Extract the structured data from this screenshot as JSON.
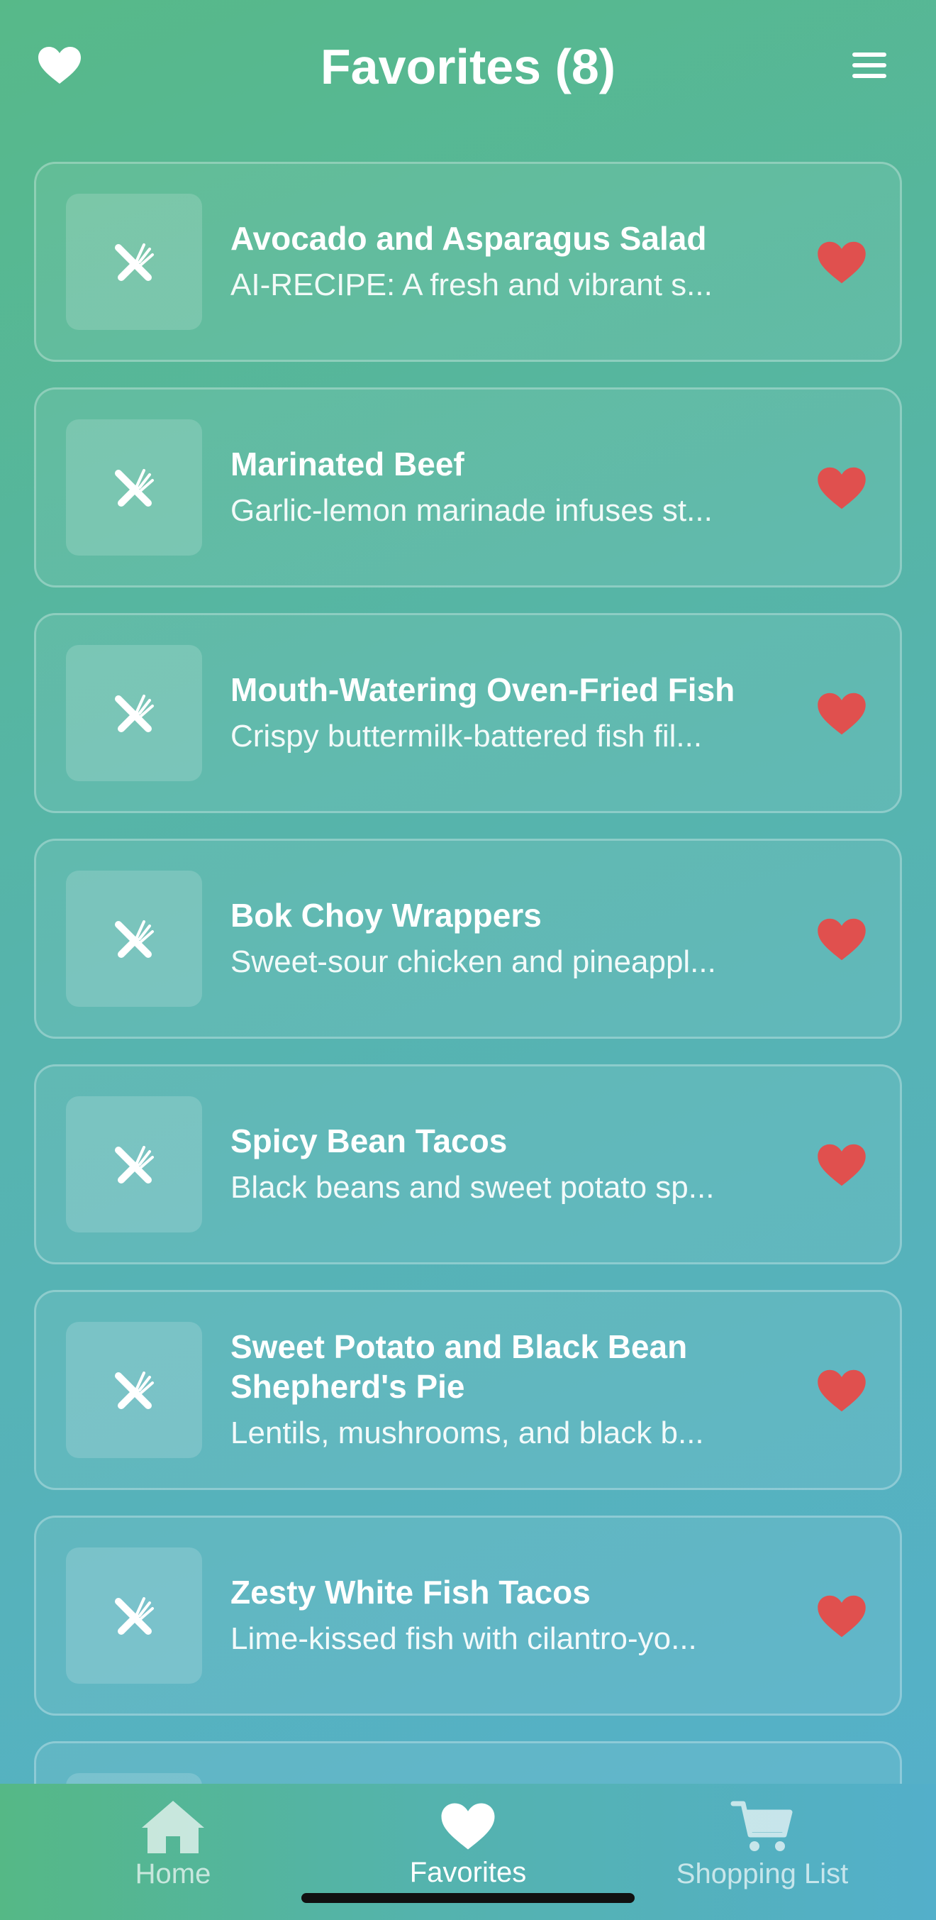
{
  "header": {
    "title": "Favorites (8)",
    "left_icon": "heart-icon",
    "right_icon": "menu-icon"
  },
  "colors": {
    "favorite_heart": "#e0504e",
    "gradient_start": "#57b989",
    "gradient_end": "#55b0cc"
  },
  "recipes": [
    {
      "title": "Avocado and Asparagus Salad",
      "description": "AI-RECIPE: A fresh and vibrant s...",
      "icon": "utensils-icon"
    },
    {
      "title": "Marinated Beef",
      "description": "Garlic-lemon marinade infuses st...",
      "icon": "utensils-icon"
    },
    {
      "title": "Mouth-Watering Oven-Fried Fish",
      "description": "Crispy buttermilk-battered fish fil...",
      "icon": "utensils-icon"
    },
    {
      "title": "Bok Choy Wrappers",
      "description": "Sweet-sour chicken and pineappl...",
      "icon": "utensils-icon"
    },
    {
      "title": "Spicy Bean Tacos",
      "description": "Black beans and sweet potato sp...",
      "icon": "utensils-icon"
    },
    {
      "title": "Sweet Potato and Black Bean Shepherd's Pie",
      "description": "Lentils, mushrooms, and black b...",
      "icon": "utensils-icon"
    },
    {
      "title": "Zesty White Fish Tacos",
      "description": "Lime-kissed fish with cilantro-yo...",
      "icon": "utensils-icon"
    },
    {
      "title": "",
      "description": "",
      "icon": "utensils-icon"
    }
  ],
  "tabs": [
    {
      "label": "Home",
      "icon": "home-icon",
      "active": false
    },
    {
      "label": "Favorites",
      "icon": "heart-icon",
      "active": true
    },
    {
      "label": "Shopping List",
      "icon": "cart-icon",
      "active": false
    }
  ]
}
